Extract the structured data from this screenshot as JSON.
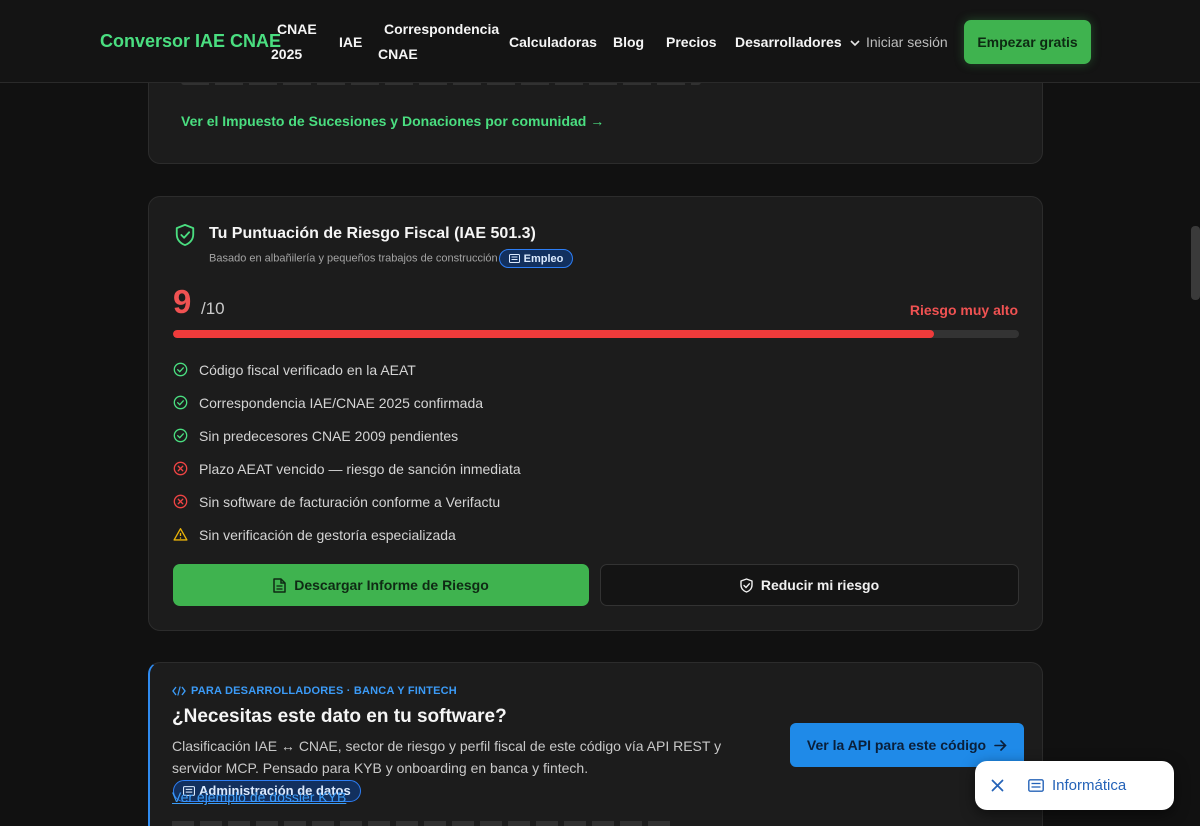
{
  "nav": {
    "brand": "Conversor IAE CNAE",
    "links": [
      "CNAE 2025",
      "IAE",
      "Correspondencia CNAE",
      "Calculadoras",
      "Blog",
      "Precios",
      "Desarrolladores"
    ],
    "cnae_line1": "CNAE",
    "cnae_line2": "2025",
    "corr_line1": "Correspondencia",
    "corr_line2": "CNAE",
    "login": "Iniciar sesión",
    "cta": "Empezar gratis",
    "dropdown_icon": "chevron-down-icon"
  },
  "succession_card": {
    "link": "Ver el Impuesto de Sucesiones y Donaciones por comunidad →"
  },
  "risk_card": {
    "title": "Tu Puntuación de Riesgo Fiscal (IAE 501.3)",
    "subtitle": "Basado en albañilería y pequeños trabajos de construcción",
    "chip": "Empleo",
    "score": "9",
    "score_max": "/10",
    "score_fraction": 0.9,
    "risk_label": "Riesgo muy alto",
    "checks": [
      {
        "status": "ok",
        "text": "Código fiscal verificado en la AEAT"
      },
      {
        "status": "ok",
        "text": "Correspondencia IAE/CNAE 2025 confirmada"
      },
      {
        "status": "ok",
        "text": "Sin predecesores CNAE 2009 pendientes"
      },
      {
        "status": "error",
        "text": "Plazo AEAT vencido — riesgo de sanción inmediata"
      },
      {
        "status": "error",
        "text": "Sin software de facturación conforme a Verifactu"
      },
      {
        "status": "warning",
        "text": "Sin verificación de gestoría especializada"
      }
    ],
    "download_button": "Descargar Informe de Riesgo",
    "reduce_button": "Reducir mi riesgo"
  },
  "dev_card": {
    "kicker": "PARA DESARROLLADORES · BANCA Y FINTECH",
    "title": "¿Necesitas este dato en tu software?",
    "description": "Clasificación IAE ↔ CNAE, sector de riesgo y perfil fiscal de este código vía API REST y servidor MCP. Pensado para KYB y onboarding en banca y fintech.",
    "chip": "Administración de datos",
    "example_link": "Ver ejemplo de dossier KYB",
    "api_button": "Ver la API para este código"
  },
  "toast": {
    "label": "Informática"
  },
  "colors": {
    "accent_green": "#3fb34f",
    "brand_green": "#4ade80",
    "danger": "#ef3b3b",
    "warning": "#eab308",
    "dev_blue": "#1f8ae8"
  }
}
